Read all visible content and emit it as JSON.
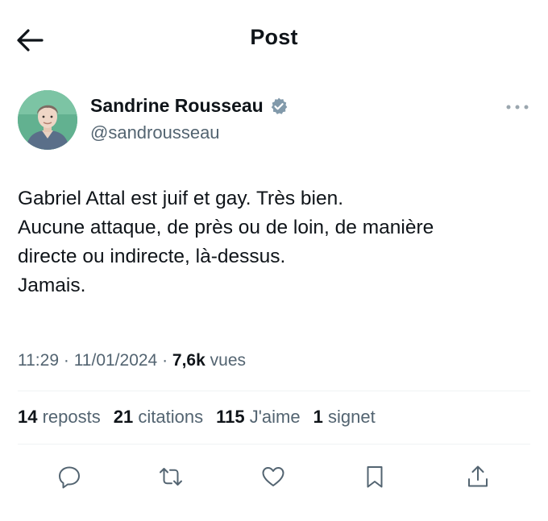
{
  "header": {
    "title": "Post",
    "back_icon": "arrow-left-icon"
  },
  "author": {
    "display_name": "Sandrine Rousseau",
    "handle": "@sandrousseau",
    "verified_icon": "verified-badge-icon",
    "avatar_bg": "#5fae8f"
  },
  "tweet": {
    "lines": [
      "Gabriel Attal est juif et gay. Très bien.",
      "Aucune attaque, de près ou de loin, de manière",
      "directe ou indirecte, là-dessus.",
      "Jamais."
    ]
  },
  "meta": {
    "time": "11:29",
    "date": "11/01/2024",
    "views_count": "7,6k",
    "views_label": "vues",
    "separator": "·"
  },
  "stats": {
    "reposts": {
      "count": "14",
      "label": "reposts"
    },
    "quotes": {
      "count": "21",
      "label": "citations"
    },
    "likes": {
      "count": "115",
      "label": "J'aime"
    },
    "bookmarks": {
      "count": "1",
      "label": "signet"
    }
  },
  "actions": [
    "reply-icon",
    "repost-icon",
    "like-icon",
    "bookmark-icon",
    "share-icon"
  ],
  "colors": {
    "text": "#0f1419",
    "secondary": "#536471",
    "divider": "#eff3f4",
    "verified": "#829aab"
  }
}
